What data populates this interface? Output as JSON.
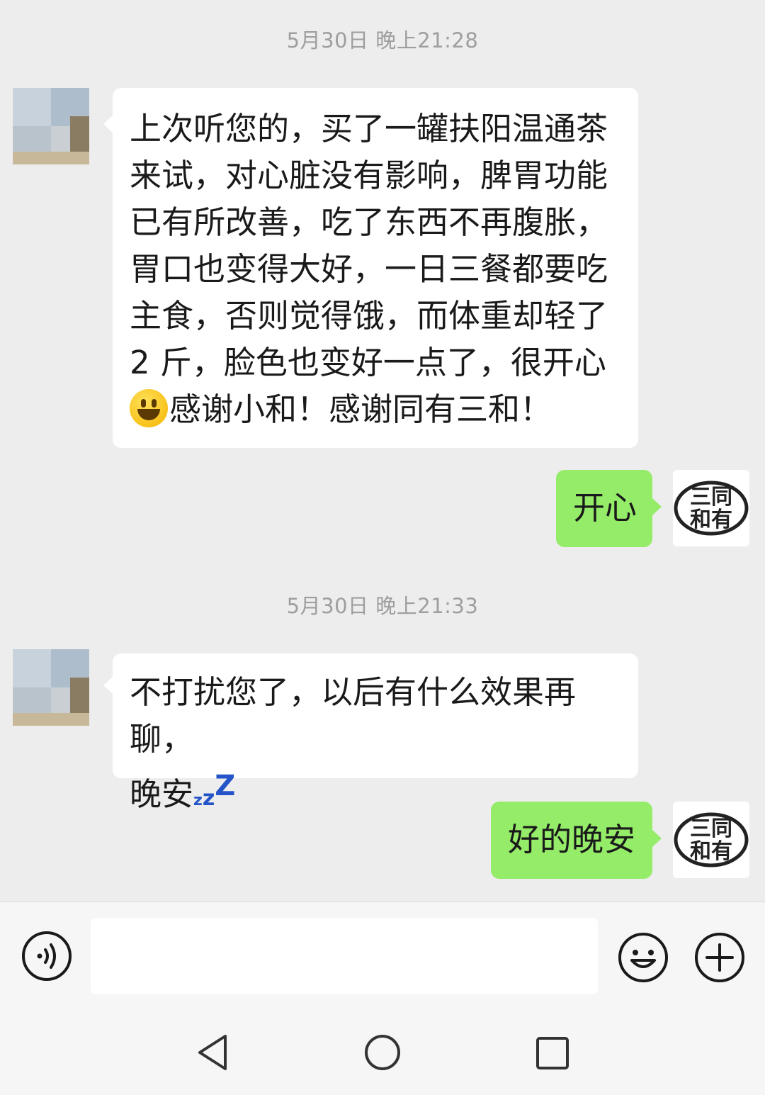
{
  "conversation": {
    "messages": [
      {
        "type": "timestamp",
        "text": "5月30日 晚上21:28"
      },
      {
        "type": "incoming",
        "lines": [
          "上次听您的，买了一罐扶阳温通茶",
          "来试，对心脏没有影响，脾胃功能",
          "已有所改善，吃了东西不再腹胀，",
          "胃口也变得大好，一日三餐都要吃",
          "主食，否则觉得饿，而体重却轻了",
          "2 斤，脸色也变好一点了，很开心"
        ],
        "last_line": "感谢小和！感谢同有三和！"
      },
      {
        "type": "outgoing",
        "text": "开心"
      },
      {
        "type": "timestamp",
        "text": "5月30日 晚上21:33"
      },
      {
        "type": "incoming",
        "lines": [
          "不打扰您了，以后有什么效果再聊，"
        ],
        "last_line": "晚安"
      },
      {
        "type": "outgoing",
        "text": "好的晚安"
      }
    ]
  },
  "avatar_logo": {
    "row1": "三同",
    "row2": "和有"
  },
  "zzz": {
    "z1": "z",
    "z2": "z",
    "z3": "Z"
  },
  "icons": {
    "voice": "voice-icon",
    "emoji": "emoji-icon",
    "plus": "plus-icon",
    "back": "back-triangle-icon",
    "home": "home-circle-icon",
    "recents": "recents-square-icon"
  },
  "colors": {
    "background": "#ededed",
    "incoming_bubble": "#ffffff",
    "outgoing_bubble": "#95ec69",
    "timestamp_text": "#9e9e9e"
  }
}
